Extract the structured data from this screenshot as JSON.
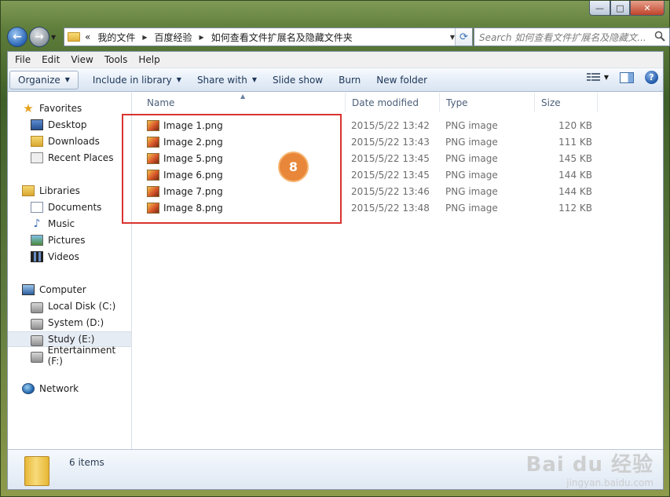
{
  "window": {
    "caption_min": "—",
    "caption_max": "□",
    "caption_close": "✕"
  },
  "address": {
    "overflow": "«",
    "segments": [
      "我的文件",
      "百度经验",
      "如何查看文件扩展名及隐藏文件夹"
    ]
  },
  "search": {
    "placeholder": "Search 如何查看文件扩展名及隐藏文..."
  },
  "menubar": [
    "File",
    "Edit",
    "View",
    "Tools",
    "Help"
  ],
  "toolbar": {
    "organize": "Organize",
    "include_in_library": "Include in library",
    "share_with": "Share with",
    "slide_show": "Slide show",
    "burn": "Burn",
    "new_folder": "New folder"
  },
  "navpane": {
    "favorites": "Favorites",
    "desktop": "Desktop",
    "downloads": "Downloads",
    "recent_places": "Recent Places",
    "libraries": "Libraries",
    "documents": "Documents",
    "music": "Music",
    "pictures": "Pictures",
    "videos": "Videos",
    "computer": "Computer",
    "local_disk": "Local Disk (C:)",
    "system": "System (D:)",
    "study": "Study (E:)",
    "entertainment": "Entertainment (F:)",
    "network": "Network"
  },
  "columns": {
    "name": "Name",
    "date_modified": "Date modified",
    "type": "Type",
    "size": "Size"
  },
  "files": [
    {
      "name": "Image 1.png",
      "date": "2015/5/22 13:42",
      "type": "PNG image",
      "size": "120 KB"
    },
    {
      "name": "Image 2.png",
      "date": "2015/5/22 13:43",
      "type": "PNG image",
      "size": "111 KB"
    },
    {
      "name": "Image 5.png",
      "date": "2015/5/22 13:45",
      "type": "PNG image",
      "size": "145 KB"
    },
    {
      "name": "Image 6.png",
      "date": "2015/5/22 13:45",
      "type": "PNG image",
      "size": "144 KB"
    },
    {
      "name": "Image 7.png",
      "date": "2015/5/22 13:46",
      "type": "PNG image",
      "size": "144 KB"
    },
    {
      "name": "Image 8.png",
      "date": "2015/5/22 13:48",
      "type": "PNG image",
      "size": "112 KB"
    }
  ],
  "step_badge": "8",
  "details": {
    "item_count": "6 items"
  },
  "watermark": {
    "brand": "Bai du 经验",
    "site": "jingyan.baidu.com"
  },
  "colors": {
    "highlight_border": "#d9332f",
    "step_badge": "#e8863a"
  }
}
